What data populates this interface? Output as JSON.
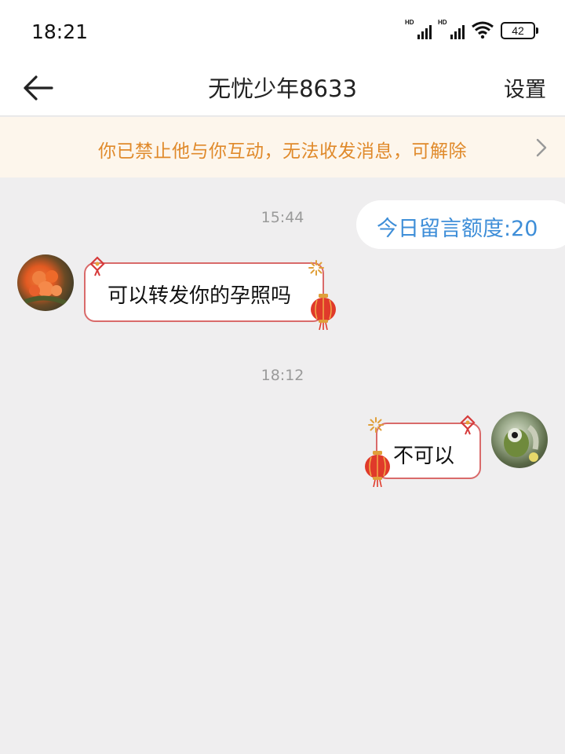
{
  "status_bar": {
    "time": "18:21",
    "signal_1_label": "HD",
    "signal_2_label": "HD",
    "wifi_icon": "wifi-icon",
    "battery_level": "42"
  },
  "header": {
    "back_icon": "arrow-left-icon",
    "title": "无忧少年8633",
    "settings_label": "设置"
  },
  "notice": {
    "text": "你已禁止他与你互动，无法收发消息，可解除",
    "chevron_icon": "chevron-right-icon"
  },
  "quota": {
    "text": "今日留言额度:20"
  },
  "messages": [
    {
      "time": "15:44",
      "sender": "other",
      "text": "可以转发你的孕照吗"
    },
    {
      "time": "18:12",
      "sender": "me",
      "text": "不可以"
    }
  ],
  "colors": {
    "notice_text": "#e08a2b",
    "notice_bg": "#fdf6ec",
    "quota_text": "#3e8ed8",
    "bubble_border": "#d96a6a",
    "background": "#efeeef"
  }
}
